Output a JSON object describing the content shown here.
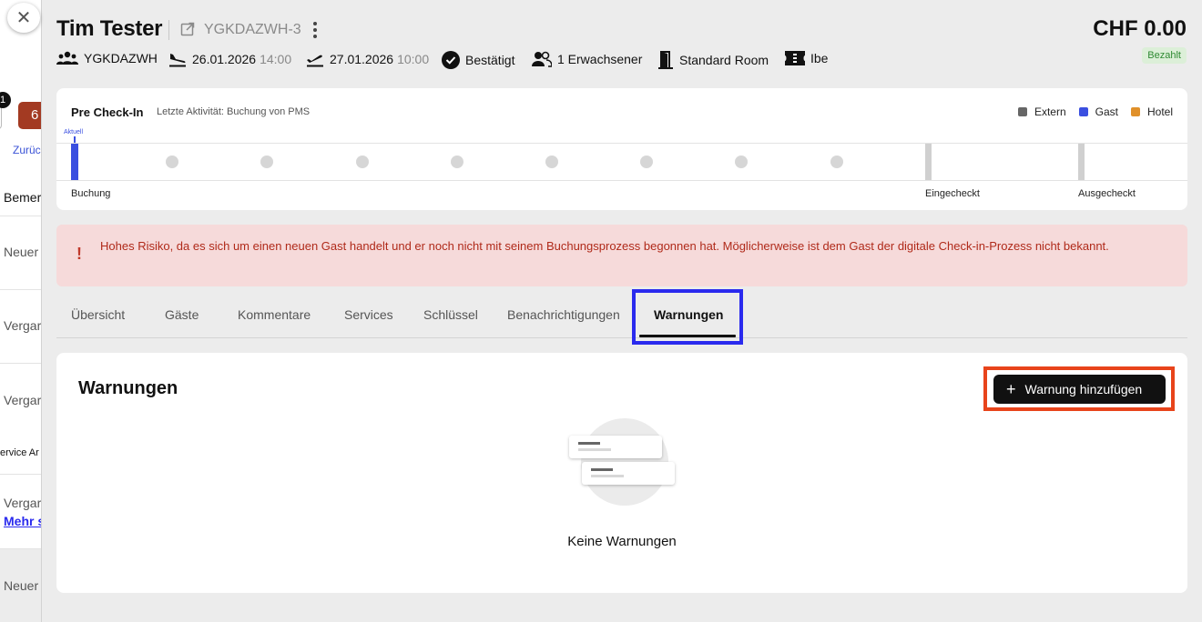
{
  "background": {
    "badge_count": "1",
    "red_badge": "6",
    "back_link": "Zurüc",
    "rows": [
      "Bemer",
      "Neuer",
      "Vergar",
      "Vergar",
      "ervice Ar",
      "Vergar",
      "Mehr s",
      "Neuer"
    ]
  },
  "header": {
    "guest_name": "Tim Tester",
    "booking_ref": "YGKDAZWH-3",
    "total": "CHF 0.00",
    "payment_status": "Bezahlt",
    "meta": {
      "group": "YGKDAZWH",
      "arrival_date": "26.01.2026",
      "arrival_time": "14:00",
      "departure_date": "27.01.2026",
      "departure_time": "10:00",
      "status": "Bestätigt",
      "guests": "1 Erwachsener",
      "room": "Standard Room",
      "source": "Ibe"
    }
  },
  "precheckin": {
    "title": "Pre Check-In",
    "last_activity": "Letzte Aktivität: Buchung von PMS",
    "current_marker": "Aktuell",
    "legend": [
      {
        "label": "Extern",
        "color": "#666666"
      },
      {
        "label": "Gast",
        "color": "#3a4fe0"
      },
      {
        "label": "Hotel",
        "color": "#e0902a"
      }
    ],
    "labels": {
      "start": "Buchung",
      "checked_in": "Eingecheckt",
      "checked_out": "Ausgecheckt"
    }
  },
  "alert": {
    "icon": "exclamation-icon",
    "text": "Hohes Risiko, da es sich um einen neuen Gast handelt und er noch nicht mit seinem Buchungsprozess begonnen hat. Möglicherweise ist dem Gast der digitale Check-in-Prozess nicht bekannt."
  },
  "tabs": {
    "items": [
      "Übersicht",
      "Gäste",
      "Kommentare",
      "Services",
      "Schlüssel",
      "Benachrichtigungen",
      "Warnungen"
    ],
    "active": "Warnungen"
  },
  "warnings": {
    "title": "Warnungen",
    "add_button": "Warnung hinzufügen",
    "empty_text": "Keine Warnungen"
  }
}
